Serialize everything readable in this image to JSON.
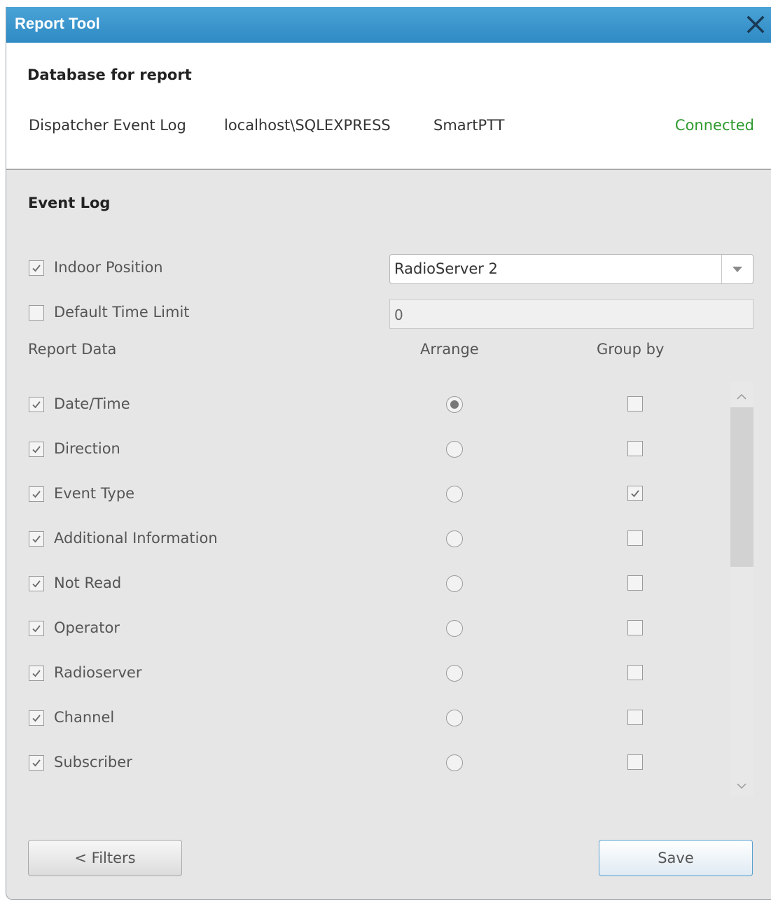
{
  "window": {
    "title": "Report Tool"
  },
  "database": {
    "header": "Database for report",
    "name": "Dispatcher Event Log",
    "server": "localhost\\SQLEXPRESS",
    "catalog": "SmartPTT",
    "status": "Connected"
  },
  "event_log": {
    "title": "Event Log",
    "indoor_position": {
      "label": "Indoor Position",
      "checked": true,
      "selected": "RadioServer 2"
    },
    "default_time_limit": {
      "label": "Default Time Limit",
      "checked": false,
      "value": "0"
    },
    "columns": {
      "report_data": "Report Data",
      "arrange": "Arrange",
      "group_by": "Group by"
    },
    "rows": [
      {
        "label": "Date/Time",
        "included": true,
        "arrange": true,
        "group": false
      },
      {
        "label": "Direction",
        "included": true,
        "arrange": false,
        "group": false
      },
      {
        "label": "Event Type",
        "included": true,
        "arrange": false,
        "group": true
      },
      {
        "label": "Additional Information",
        "included": true,
        "arrange": false,
        "group": false
      },
      {
        "label": "Not Read",
        "included": true,
        "arrange": false,
        "group": false
      },
      {
        "label": "Operator",
        "included": true,
        "arrange": false,
        "group": false
      },
      {
        "label": "Radioserver",
        "included": true,
        "arrange": false,
        "group": false
      },
      {
        "label": "Channel",
        "included": true,
        "arrange": false,
        "group": false
      },
      {
        "label": "Subscriber",
        "included": true,
        "arrange": false,
        "group": false
      }
    ]
  },
  "buttons": {
    "filters": "< Filters",
    "save": "Save"
  },
  "colors": {
    "title_bar": "#2f8ac4",
    "status_connected": "#2e9a2e"
  },
  "icons": {
    "close": "close-icon",
    "dropdown": "chevron-down-icon",
    "check": "check-icon"
  }
}
